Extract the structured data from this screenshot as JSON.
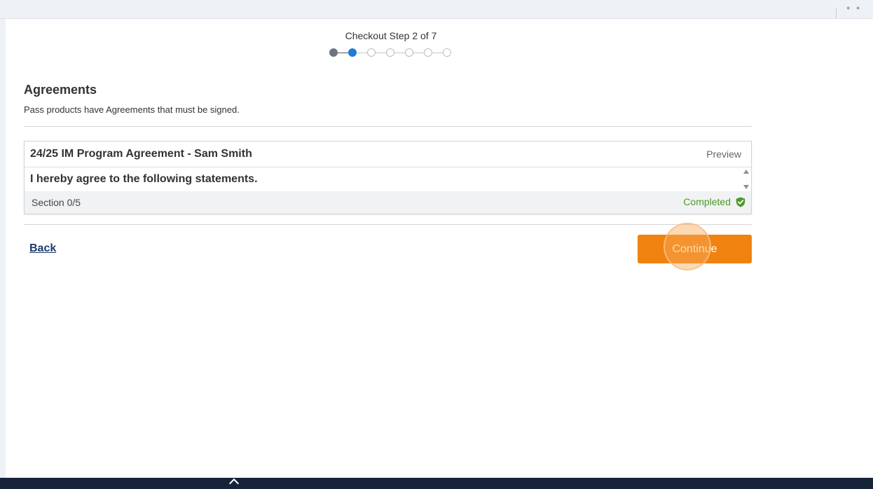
{
  "checkout": {
    "step_label": "Checkout Step 2 of 7",
    "current_step": 2,
    "total_steps": 7
  },
  "agreements": {
    "title": "Agreements",
    "subtitle": "Pass products have Agreements that must be signed.",
    "card": {
      "title": "24/25 IM Program Agreement - Sam Smith",
      "preview_label": "Preview",
      "statement": "I hereby agree to the following statements.",
      "section_label": "Section 0/5",
      "status_label": "Completed"
    }
  },
  "actions": {
    "back_label": "Back",
    "continue_label": "Continue"
  },
  "colors": {
    "accent_orange": "#f0820f",
    "step_active": "#1f7ad9",
    "step_done": "#6b7480",
    "completed_green": "#4c9a2a",
    "link_navy": "#1e3a6e",
    "footer_navy": "#172339"
  },
  "icons": {
    "status_icon": "shield-check-icon",
    "scroll_up": "scroll-up-arrow-icon",
    "scroll_down": "scroll-down-arrow-icon",
    "footer_icon": "chevron-up-icon"
  }
}
